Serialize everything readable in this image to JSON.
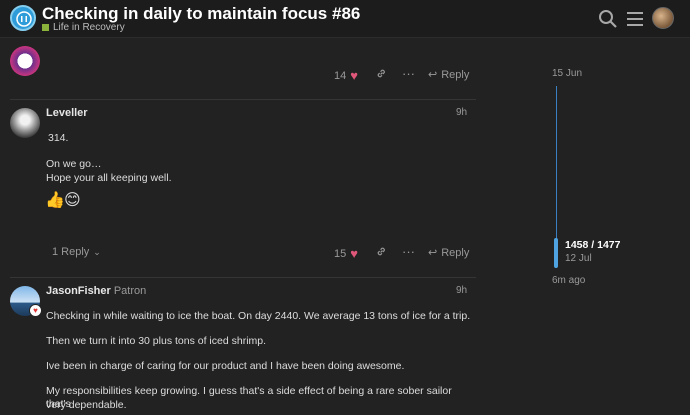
{
  "header": {
    "title": "Checking in daily to maintain focus #86",
    "category": "Life in Recovery",
    "category_color": "#8bb33c",
    "icons": [
      "search-icon",
      "hamburger-menu-icon",
      "user-avatar"
    ]
  },
  "posts": [
    {
      "likes": "14",
      "reply_label": "Reply"
    },
    {
      "username": "Leveller",
      "date": "9h",
      "lines": [
        "314.",
        "On we go…",
        "Hope your all keeping well."
      ],
      "emoji": [
        "👍",
        "😊"
      ],
      "replies_label": "1 Reply",
      "likes": "15",
      "reply_label": "Reply"
    },
    {
      "username": "JasonFisher",
      "user_title": "Patron",
      "date": "9h",
      "paragraphs": [
        "Checking in while waiting to ice the boat. On day 2440. We average 13 tons of ice for a trip.",
        "Then we turn it into 30 plus tons of iced shrimp.",
        "Ive been in charge of caring for our product and I have been doing awesome.",
        "My responsibilities keep growing. I guess that's a side effect of being a rare sober sailor that's",
        "very dependable."
      ]
    }
  ],
  "timeline": {
    "start_date": "15 Jun",
    "position": "1458 / 1477",
    "current_date": "12 Jul",
    "last_activity": "6m ago",
    "progress_fraction": 0.987
  }
}
